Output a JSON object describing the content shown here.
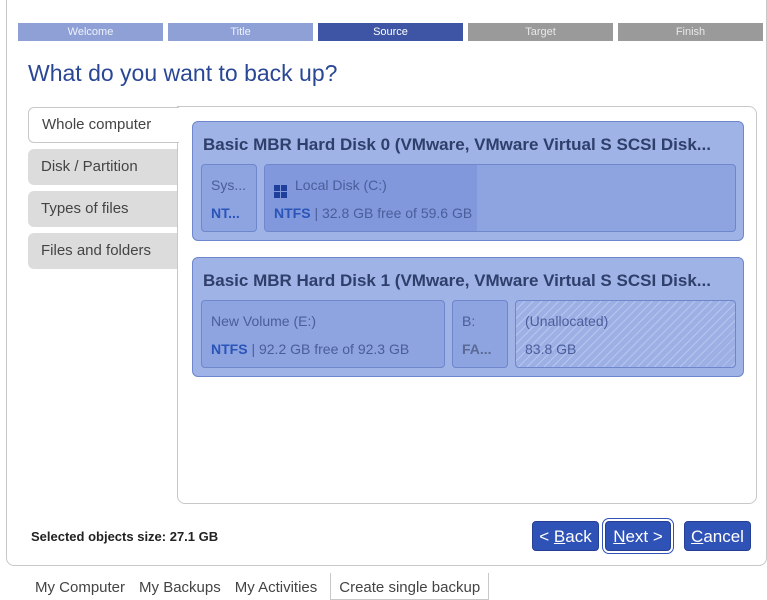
{
  "steps": [
    "Welcome",
    "Title",
    "Source",
    "Target",
    "Finish"
  ],
  "page_title": "What do you want to back up?",
  "tabs": [
    "Whole computer",
    "Disk / Partition",
    "Types of files",
    "Files and folders"
  ],
  "disks": [
    {
      "title": "Basic MBR Hard Disk 0 (VMware, VMware Virtual S SCSI Disk...",
      "partitions": [
        {
          "name": "Sys...",
          "fs": "NT...",
          "info": ""
        },
        {
          "name": "Local Disk (C:)",
          "fs": "NTFS",
          "info": "| 32.8 GB free of 59.6 GB",
          "icon": "windows-icon"
        }
      ]
    },
    {
      "title": "Basic MBR Hard Disk 1 (VMware, VMware Virtual S SCSI Disk...",
      "partitions": [
        {
          "name": "New Volume (E:)",
          "fs": "NTFS",
          "info": "| 92.2 GB free of 92.3 GB"
        },
        {
          "name": "B:",
          "fs": "FA...",
          "info": ""
        },
        {
          "name": "(Unallocated)",
          "fs": "",
          "info": "83.8 GB"
        }
      ]
    }
  ],
  "footer": {
    "selected_size": "Selected objects size: 27.1 GB",
    "back_label": "< ",
    "back_accel": "B",
    "back_rest": "ack",
    "next_accel": "N",
    "next_rest": "ext >",
    "cancel_accel": "C",
    "cancel_rest": "ancel"
  },
  "bottom_tabs": [
    "My Computer",
    "My Backups",
    "My Activities",
    "Create single backup"
  ],
  "colors": {
    "accent": "#2f52b6",
    "step_current": "#3d55a4",
    "step_done": "#8ea0d6",
    "step_todo": "#9a9a9a",
    "disk_bg": "#9fb3e6"
  }
}
